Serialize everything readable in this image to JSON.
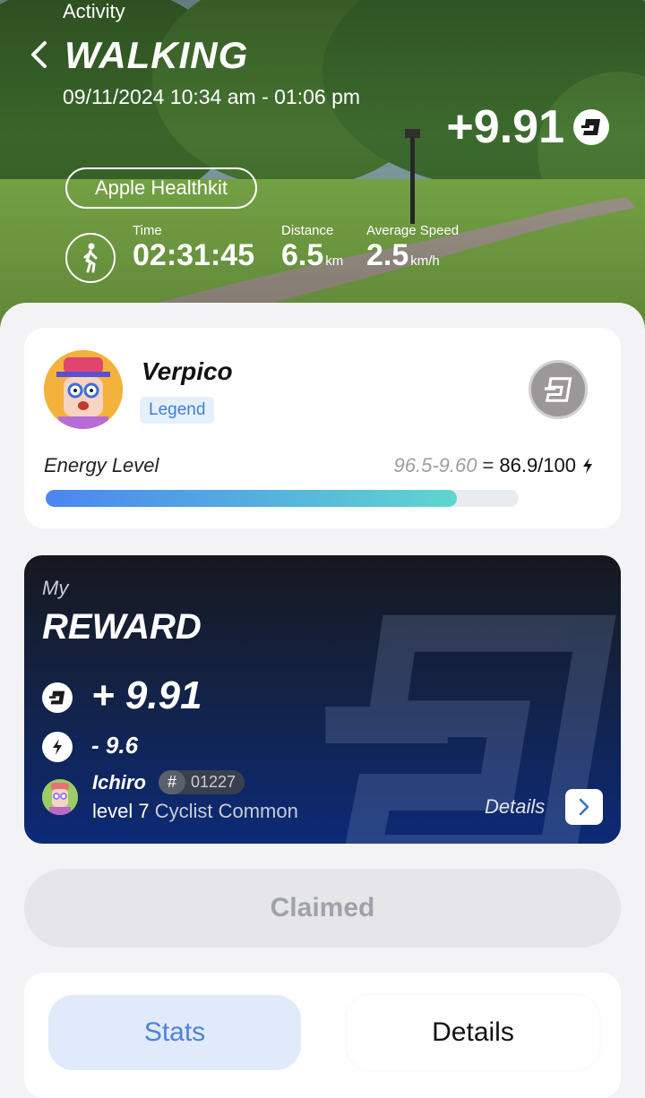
{
  "header": {
    "section_label": "Activity",
    "title": "WALKING",
    "datetime": "09/11/2024 10:34 am - 01:06 pm",
    "reward_value": "+9.91",
    "source_button": "Apple Healthkit",
    "stats": [
      {
        "label": "Time",
        "value": "02:31:45",
        "unit": ""
      },
      {
        "label": "Distance",
        "value": "6.5",
        "unit": "km"
      },
      {
        "label": "Average Speed",
        "value": "2.5",
        "unit": "km/h"
      }
    ]
  },
  "user": {
    "name": "Verpico",
    "badge": "Legend",
    "energy_label": "Energy Level",
    "energy_formula": "96.5-9.60",
    "energy_equals": "=",
    "energy_result": "86.9/100",
    "energy_fraction": 0.869
  },
  "reward": {
    "my_label": "My",
    "title": "REWARD",
    "amount": "+ 9.91",
    "energy_cost": "- 9.6",
    "nft_name": "Ichiro",
    "nft_hash": "#",
    "nft_id": "01227",
    "nft_level": "level 7",
    "nft_class": "Cyclist Common",
    "details_label": "Details"
  },
  "claim_button": "Claimed",
  "tabs": [
    {
      "label": "Stats",
      "active": true
    },
    {
      "label": "Details",
      "active": false
    }
  ],
  "colors": {
    "accent_blue": "#4f82da",
    "energy_gradient_start": "#4a86f0",
    "energy_gradient_end": "#5fd6cf",
    "reward_card_dark": "#16181f",
    "reward_card_blue": "#0c2a77"
  },
  "icons": [
    "back-chevron-icon",
    "token-icon",
    "walking-icon",
    "lightning-icon",
    "chevron-right-icon"
  ]
}
